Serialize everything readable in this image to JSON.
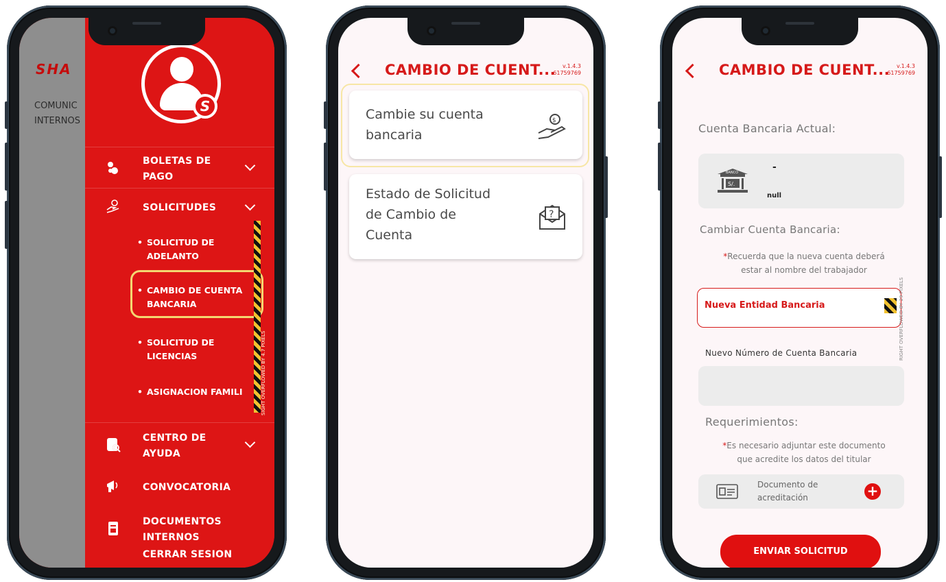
{
  "phone1": {
    "brand": "SHA",
    "gray_text": [
      "COMUNIC",
      "INTERNOS"
    ],
    "menu": [
      {
        "label": "BOLETAS DE\nPAGO",
        "icon": "coins-icon"
      },
      {
        "label": "SOLICITUDES",
        "icon": "hand-money-icon"
      },
      {
        "label": "CENTRO DE\nAYUDA",
        "icon": "document-search-icon"
      },
      {
        "label": "CONVOCATORIA",
        "icon": "megaphone-icon"
      },
      {
        "label": "DOCUMENTOS\nINTERNOS",
        "icon": "document-icon"
      }
    ],
    "sub_items": [
      "SOLICITUD DE\nADELANTO",
      "CAMBIO DE CUENTA\nBANCARIA",
      "SOLICITUD DE\nLICENCIAS",
      "ASIGNACION FAMILI"
    ],
    "logout": "CERRAR SESION",
    "watermark": "SIGHT OVERFLOWED BY 4.7 PIXELS"
  },
  "phone2": {
    "title": "CAMBIO DE CUENT...",
    "version": "v.1.4.3",
    "build": "61759769",
    "cards": [
      {
        "text": "Cambie su cuenta\nbancaria",
        "icon": "hand-coin-icon"
      },
      {
        "text": "Estado de Solicitud\nde Cambio de\nCuenta",
        "icon": "envelope-question-icon"
      }
    ]
  },
  "phone3": {
    "title": "CAMBIO DE CUENT...",
    "version": "v.1.4.3",
    "build": "61759769",
    "current_account_label": "Cuenta Bancaria Actual:",
    "bank_dash": "-",
    "bank_null": "null",
    "bank_logo_text": "BANCO",
    "bank_currency": "S/.",
    "change_label": "Cambiar Cuenta Bancaria:",
    "note1_asterisk": "*",
    "note1": "Recuerda que la nueva cuenta deberá\nestar al nombre del trabajador",
    "new_bank_placeholder": "Nueva Entidad Bancaria",
    "new_account_label": "Nuevo Número de Cuenta Bancaria",
    "requirements_label": "Requerimientos:",
    "note2_asterisk": "*",
    "note2": "Es necesario adjuntar este documento\nque acredite los datos del titular",
    "document_label": "Documento de\nacreditación",
    "submit": "ENVIAR SOLICITUD",
    "overflow_text": "RIGHT OVERFLOWED BY 29 PIXELS"
  }
}
